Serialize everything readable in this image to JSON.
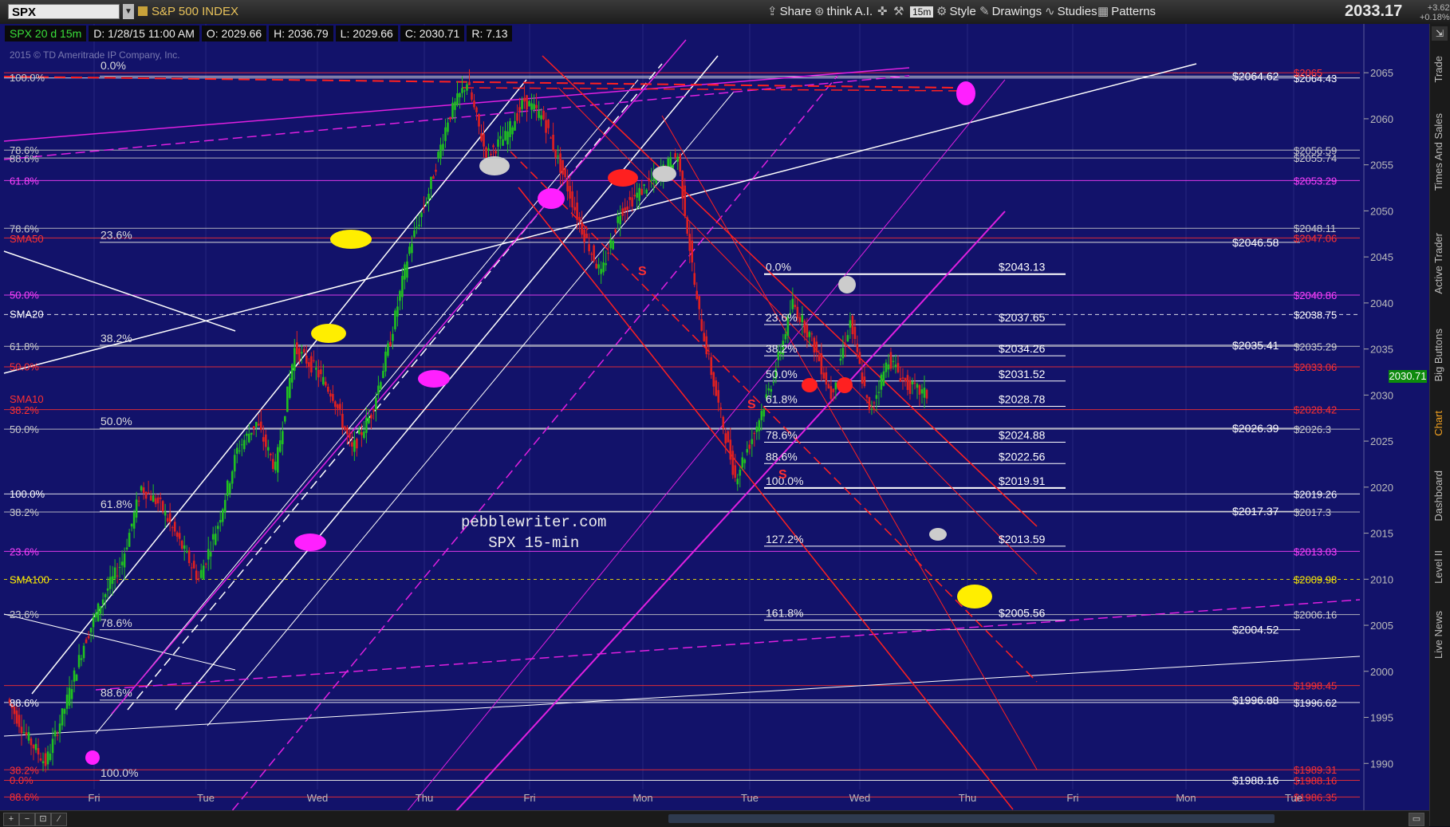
{
  "toolbar": {
    "symbol": "SPX",
    "index_name": "S&P 500 INDEX",
    "share": "Share",
    "think_ai": "think A.I.",
    "timeframe": "15m",
    "style": "Style",
    "drawings": "Drawings",
    "studies": "Studies",
    "patterns": "Patterns",
    "last_price": "2033.17",
    "change_abs": "+3.62",
    "change_pct": "+0.18%"
  },
  "infobar": {
    "chart_id": "SPX 20 d 15m",
    "datetime": "D: 1/28/15 11:00 AM",
    "open": "O: 2029.66",
    "high": "H: 2036.79",
    "low": "L: 2029.66",
    "close": "C: 2030.71",
    "range": "R: 7.13"
  },
  "copyright": "2015 © TD Ameritrade IP Company, Inc.",
  "watermark": {
    "line1": "pebblewriter.com",
    "line2": "SPX 15-min"
  },
  "current_price_tag": "2030.71",
  "sidebar": {
    "trade": "Trade",
    "times_sales": "Times And Sales",
    "active_trader": "Active Trader",
    "big_buttons": "Big Buttons",
    "chart": "Chart",
    "dashboard": "Dashboard",
    "level2": "Level II",
    "live_news": "Live News"
  },
  "colors": {
    "background": "#12126a",
    "magenta": "#e020e0",
    "red": "#ff2020",
    "white": "#ffffff",
    "yellow": "#ffee00",
    "up": "#20c020",
    "down": "#e02020"
  },
  "chart_data": {
    "type": "candlestick",
    "symbol": "SPX",
    "interval": "15m",
    "period": "20 d",
    "ylim": [
      1985,
      2069
    ],
    "y_ticks": [
      1990,
      1995,
      2000,
      2005,
      2010,
      2015,
      2020,
      2025,
      2030,
      2035,
      2040,
      2045,
      2050,
      2055,
      2060,
      2065
    ],
    "x_labels": [
      "Fri",
      "Tue",
      "Wed",
      "Thu",
      "Fri",
      "Mon",
      "Tue",
      "Wed",
      "Thu",
      "Fri",
      "Mon",
      "Tue"
    ],
    "right_price_labels": [
      {
        "value": 2064.43,
        "text": "$2064.43",
        "color": "#ffffff"
      },
      {
        "value": 2065.0,
        "text": "$2065",
        "color": "#ff3030"
      },
      {
        "value": 2056.59,
        "text": "$2056.59",
        "color": "#cccccc"
      },
      {
        "value": 2055.74,
        "text": "$2055.74",
        "color": "#cccccc"
      },
      {
        "value": 2053.29,
        "text": "$2053.29",
        "color": "#ff40ff"
      },
      {
        "value": 2048.11,
        "text": "$2048.11",
        "color": "#cccccc"
      },
      {
        "value": 2047.06,
        "text": "$2047.06",
        "color": "#ff3030"
      },
      {
        "value": 2040.86,
        "text": "$2040.86",
        "color": "#ff40ff"
      },
      {
        "value": 2038.75,
        "text": "$2038.75",
        "color": "#ffffff"
      },
      {
        "value": 2035.29,
        "text": "$2035.29",
        "color": "#cccccc"
      },
      {
        "value": 2033.06,
        "text": "$2033.06",
        "color": "#ff3030"
      },
      {
        "value": 2028.42,
        "text": "$2028.42",
        "color": "#ff3030"
      },
      {
        "value": 2026.3,
        "text": "$2026.3",
        "color": "#cccccc"
      },
      {
        "value": 2019.26,
        "text": "$2019.26",
        "color": "#ffffff"
      },
      {
        "value": 2017.3,
        "text": "$2017.3",
        "color": "#cccccc"
      },
      {
        "value": 2013.03,
        "text": "$2013.03",
        "color": "#ff40ff"
      },
      {
        "value": 2009.98,
        "text": "$2009.98",
        "color": "#ffee00"
      },
      {
        "value": 2006.16,
        "text": "$2006.16",
        "color": "#cccccc"
      },
      {
        "value": 1998.45,
        "text": "$1998.45",
        "color": "#ff3030"
      },
      {
        "value": 1996.62,
        "text": "$1996.62",
        "color": "#ffffff"
      },
      {
        "value": 1989.31,
        "text": "$1989.31",
        "color": "#ff3030"
      },
      {
        "value": 1988.16,
        "text": "$1988.16",
        "color": "#ff3030"
      },
      {
        "value": 1986.35,
        "text": "$1986.35",
        "color": "#ff3030"
      }
    ],
    "level_labels": [
      {
        "value": 2064.62,
        "text": "$2064.62"
      },
      {
        "value": 2046.58,
        "text": "$2046.58"
      },
      {
        "value": 2035.41,
        "text": "$2035.41"
      },
      {
        "value": 2026.39,
        "text": "$2026.39"
      },
      {
        "value": 2017.37,
        "text": "$2017.37"
      },
      {
        "value": 2004.52,
        "text": "$2004.52"
      },
      {
        "value": 1996.88,
        "text": "$1996.88"
      },
      {
        "value": 1988.16,
        "text": "$1988.16"
      }
    ],
    "fib_right": [
      {
        "pct": "0.0%",
        "value": 2043.13,
        "text": "$2043.13"
      },
      {
        "pct": "23.6%",
        "value": 2037.65,
        "text": "$2037.65"
      },
      {
        "pct": "38.2%",
        "value": 2034.26,
        "text": "$2034.26"
      },
      {
        "pct": "50.0%",
        "value": 2031.52,
        "text": "$2031.52"
      },
      {
        "pct": "61.8%",
        "value": 2028.78,
        "text": "$2028.78"
      },
      {
        "pct": "78.6%",
        "value": 2024.88,
        "text": "$2024.88"
      },
      {
        "pct": "88.6%",
        "value": 2022.56,
        "text": "$2022.56"
      },
      {
        "pct": "100.0%",
        "value": 2019.91,
        "text": "$2019.91"
      },
      {
        "pct": "127.2%",
        "value": 2013.59,
        "text": "$2013.59"
      },
      {
        "pct": "161.8%",
        "value": 2005.56,
        "text": "$2005.56"
      }
    ],
    "fib_left": [
      {
        "pct": "0.0%",
        "value": 2065.0
      },
      {
        "pct": "23.6%",
        "value": 2046.6
      },
      {
        "pct": "38.2%",
        "value": 2035.4
      },
      {
        "pct": "50.0%",
        "value": 2026.4
      },
      {
        "pct": "61.8%",
        "value": 2017.4
      },
      {
        "pct": "78.6%",
        "value": 2004.5
      },
      {
        "pct": "88.6%",
        "value": 1996.9
      },
      {
        "pct": "100.0%",
        "value": 1988.2
      }
    ],
    "edge_labels": [
      {
        "value": 2064.5,
        "text": "100.0%",
        "color": "#cccccc"
      },
      {
        "value": 2056.6,
        "text": "78.6%",
        "color": "#cccccc"
      },
      {
        "value": 2055.7,
        "text": "88.6%",
        "color": "#cccccc"
      },
      {
        "value": 2053.3,
        "text": "61.8%",
        "color": "#ff40ff"
      },
      {
        "value": 2048.1,
        "text": "78.6%",
        "color": "#cccccc"
      },
      {
        "value": 2047.0,
        "text": "SMA50",
        "color": "#ff3030"
      },
      {
        "value": 2040.9,
        "text": "50.0%",
        "color": "#ff40ff"
      },
      {
        "value": 2038.8,
        "text": "SMA20",
        "color": "#ffffff"
      },
      {
        "value": 2035.3,
        "text": "61.8%",
        "color": "#cccccc"
      },
      {
        "value": 2033.1,
        "text": "50.0%",
        "color": "#ff3030"
      },
      {
        "value": 2029.6,
        "text": "SMA10",
        "color": "#ff3030"
      },
      {
        "value": 2028.4,
        "text": "38.2%",
        "color": "#ff3030"
      },
      {
        "value": 2026.3,
        "text": "50.0%",
        "color": "#cccccc"
      },
      {
        "value": 2019.3,
        "text": "100.0%",
        "color": "#ffffff"
      },
      {
        "value": 2017.3,
        "text": "38.2%",
        "color": "#cccccc"
      },
      {
        "value": 2013.0,
        "text": "23.6%",
        "color": "#ff40ff"
      },
      {
        "value": 2010.0,
        "text": "SMA100",
        "color": "#ffee00"
      },
      {
        "value": 2006.2,
        "text": "23.6%",
        "color": "#cccccc"
      },
      {
        "value": 1996.6,
        "text": "88.6%",
        "color": "#ffffff"
      },
      {
        "value": 1989.3,
        "text": "38.2%",
        "color": "#ff3030"
      },
      {
        "value": 1988.2,
        "text": "0.0%",
        "color": "#ff3030"
      },
      {
        "value": 1986.4,
        "text": "88.6%",
        "color": "#ff3030"
      }
    ],
    "annotations": [
      "S",
      "S",
      "S"
    ],
    "series": [
      {
        "name": "SPX",
        "values": [
          1997,
          1993,
          1990,
          1996,
          2003,
          2008,
          2012,
          2020,
          2018,
          2014,
          2010,
          2016,
          2024,
          2027,
          2022,
          2035,
          2033,
          2030,
          2024,
          2028,
          2036,
          2046,
          2052,
          2060,
          2064,
          2056,
          2058,
          2062,
          2060,
          2054,
          2048,
          2043,
          2050,
          2052,
          2054,
          2056,
          2040,
          2030,
          2021,
          2026,
          2032,
          2040,
          2036,
          2030,
          2038,
          2028,
          2034,
          2031,
          2030
        ]
      }
    ]
  }
}
